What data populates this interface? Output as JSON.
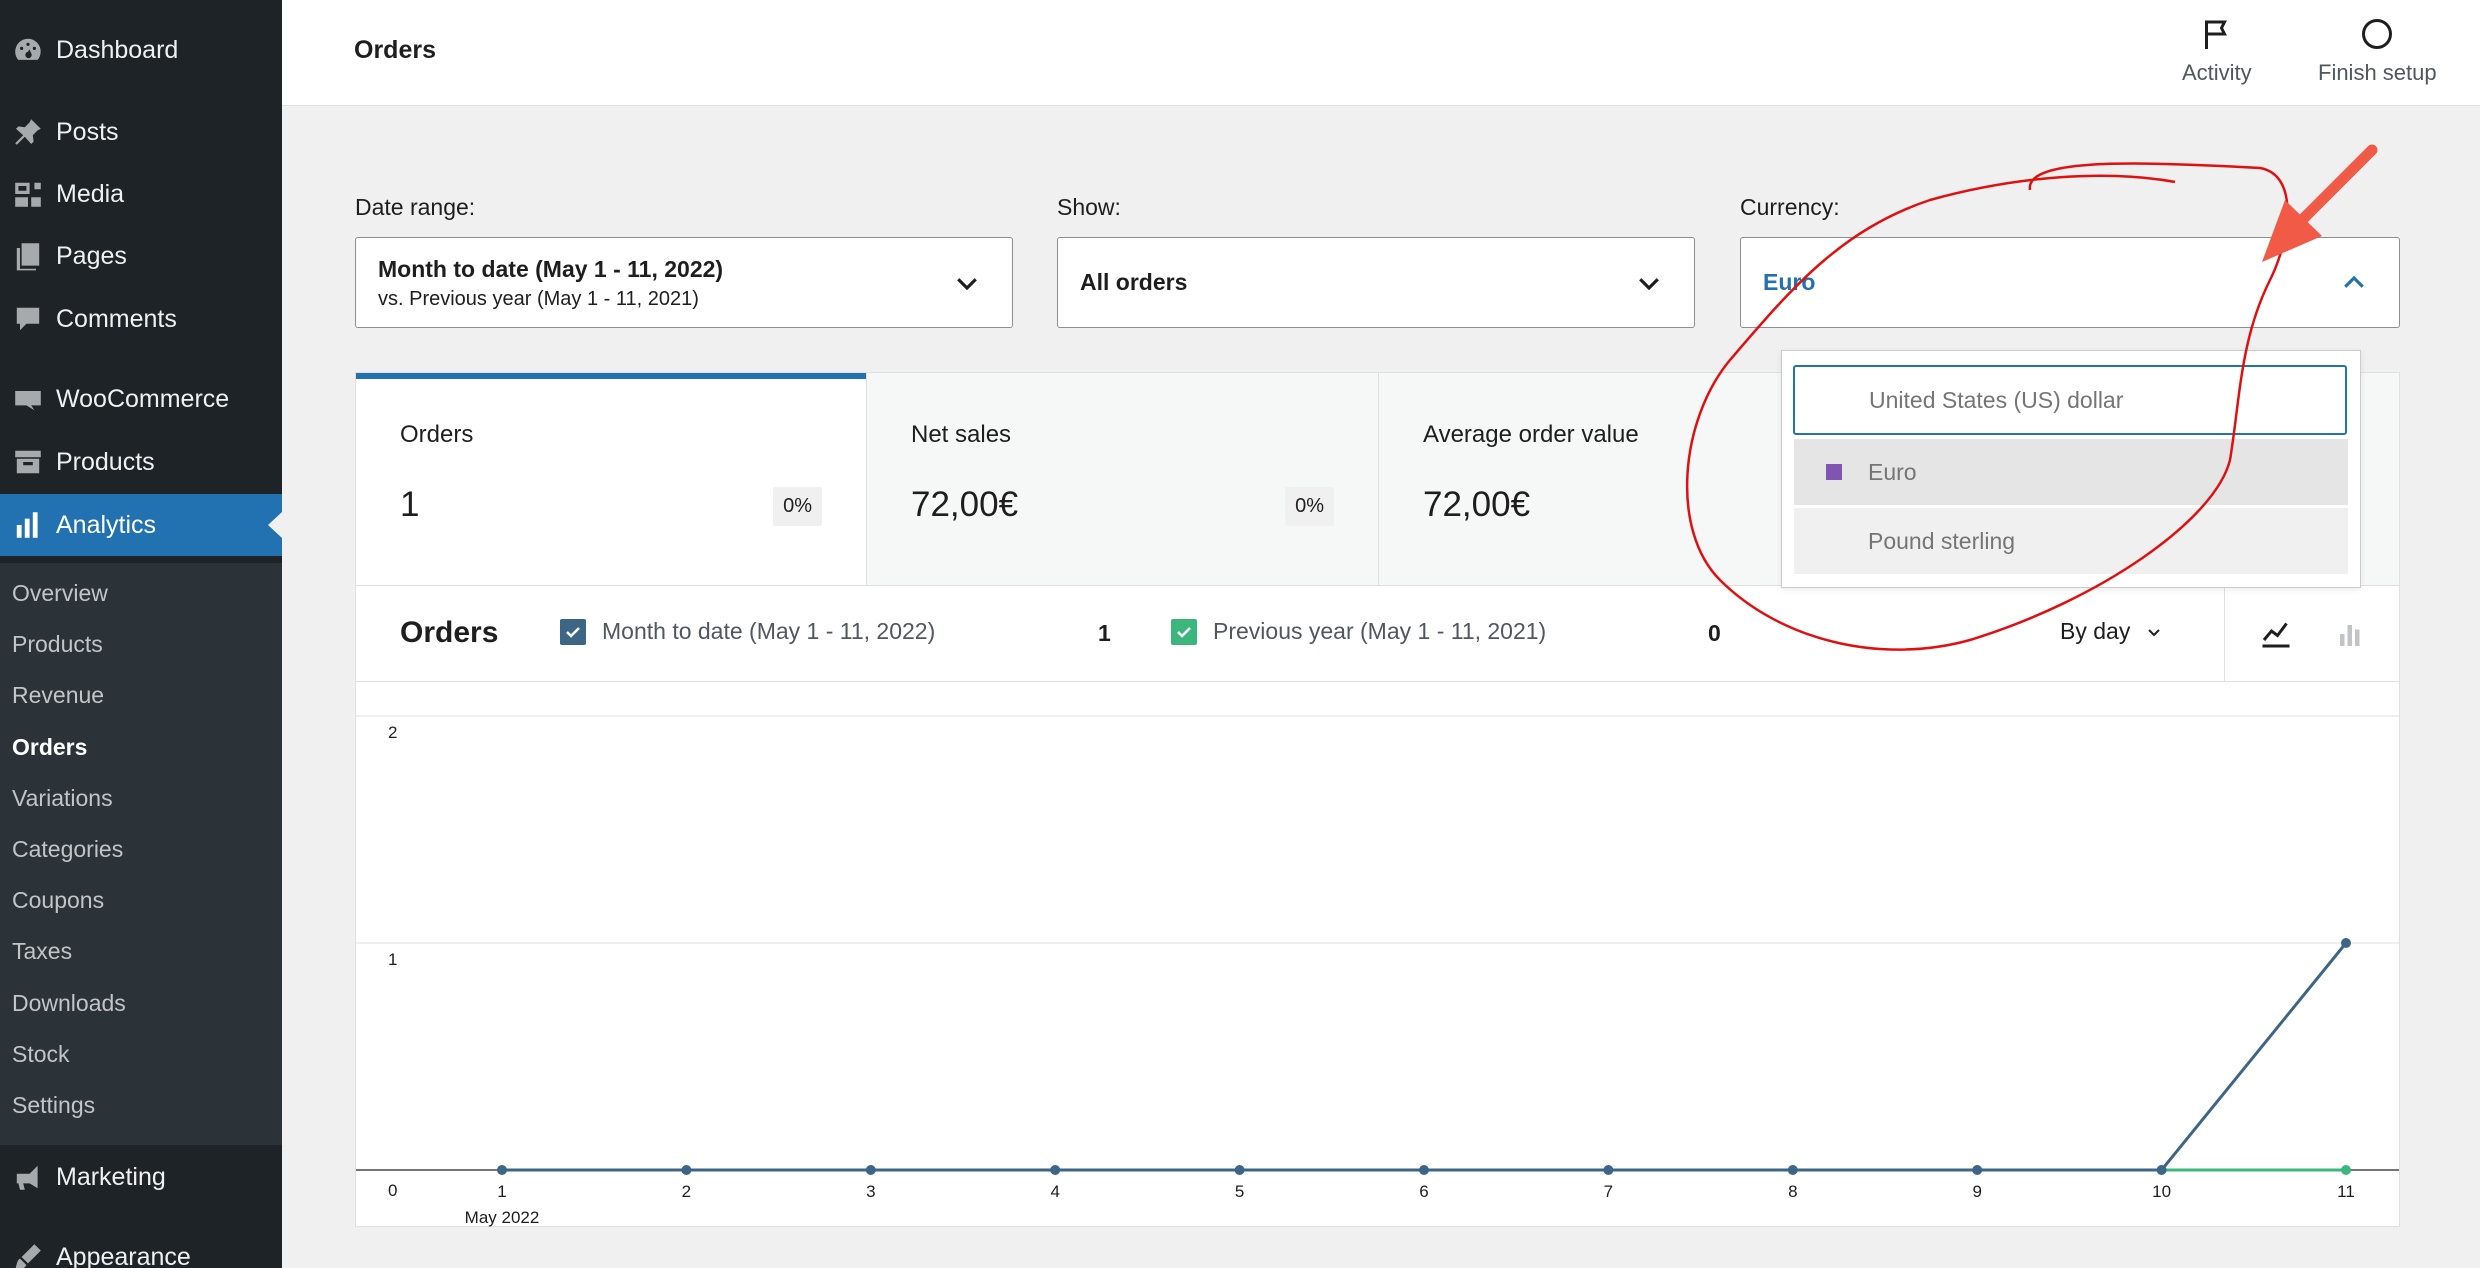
{
  "sidebar": {
    "items": [
      {
        "label": "Dashboard",
        "icon": "dashboard-icon"
      },
      {
        "label": "Posts",
        "icon": "pin-icon"
      },
      {
        "label": "Media",
        "icon": "media-icon"
      },
      {
        "label": "Pages",
        "icon": "pages-icon"
      },
      {
        "label": "Comments",
        "icon": "comment-icon"
      },
      {
        "label": "WooCommerce",
        "icon": "woo-icon"
      },
      {
        "label": "Products",
        "icon": "archive-icon"
      },
      {
        "label": "Analytics",
        "icon": "bar-chart-icon"
      },
      {
        "label": "Marketing",
        "icon": "megaphone-icon"
      },
      {
        "label": "Appearance",
        "icon": "brush-icon"
      }
    ],
    "submenu": [
      "Overview",
      "Products",
      "Revenue",
      "Orders",
      "Variations",
      "Categories",
      "Coupons",
      "Taxes",
      "Downloads",
      "Stock",
      "Settings"
    ]
  },
  "header": {
    "title": "Orders",
    "activity_label": "Activity",
    "finish_setup_label": "Finish setup"
  },
  "filters": {
    "date_range": {
      "label": "Date range:",
      "value": "Month to date (May 1 - 11, 2022)",
      "compare": "vs. Previous year (May 1 - 11, 2021)"
    },
    "show": {
      "label": "Show:",
      "value": "All orders"
    },
    "currency": {
      "label": "Currency:",
      "value": "Euro",
      "options": [
        {
          "label": "United States (US) dollar",
          "state": "focused"
        },
        {
          "label": "Euro",
          "state": "selected"
        },
        {
          "label": "Pound sterling",
          "state": "normal"
        }
      ]
    }
  },
  "summary": [
    {
      "label": "Orders",
      "value": "1",
      "delta": "0%"
    },
    {
      "label": "Net sales",
      "value": "72,00€",
      "delta": "0%"
    },
    {
      "label": "Average order value",
      "value": "72,00€"
    }
  ],
  "chart_header": {
    "title": "Orders",
    "primary_legend": "Month to date (May 1 - 11, 2022)",
    "primary_total": "1",
    "secondary_legend": "Previous year (May 1 - 11, 2021)",
    "secondary_total": "0",
    "interval": "By day"
  },
  "colors": {
    "primary": "#2271b1",
    "series_current": "#3c6586",
    "series_previous": "#3bb77e",
    "swatch": "#7f54b3",
    "annotation": "#e01010",
    "arrow": "#f05a47"
  },
  "chart_data": {
    "type": "line",
    "x": [
      "1",
      "2",
      "3",
      "4",
      "5",
      "6",
      "7",
      "8",
      "9",
      "10",
      "11"
    ],
    "x_sublabel": "May 2022",
    "y_ticks": [
      0,
      1,
      2
    ],
    "ylim": [
      0,
      2
    ],
    "series": [
      {
        "name": "Month to date (May 1 - 11, 2022)",
        "values": [
          0,
          0,
          0,
          0,
          0,
          0,
          0,
          0,
          0,
          0,
          1
        ]
      },
      {
        "name": "Previous year (May 1 - 11, 2021)",
        "values": [
          0,
          0,
          0,
          0,
          0,
          0,
          0,
          0,
          0,
          0,
          0
        ]
      }
    ],
    "grid": true
  }
}
